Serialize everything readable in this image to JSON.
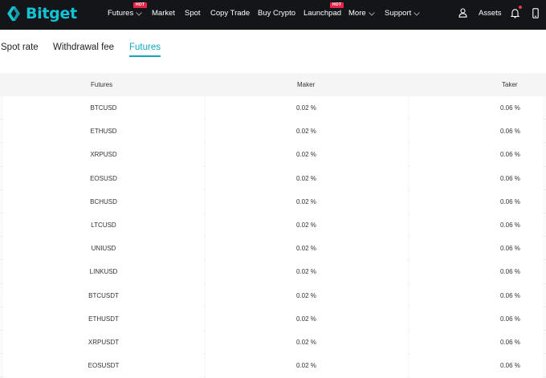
{
  "brand": {
    "name": "Bitget",
    "color": "#12c4d6"
  },
  "nav": {
    "futures": "Futures",
    "market": "Market",
    "spot": "Spot",
    "copy_trade": "Copy Trade",
    "buy_crypto": "Buy Crypto",
    "launchpad": "Launchpad",
    "more": "More",
    "support": "Support",
    "assets": "Assets",
    "hot_badge": "HOT"
  },
  "tabs": [
    {
      "label": "Spot rate",
      "active": false
    },
    {
      "label": "Withdrawal fee",
      "active": false
    },
    {
      "label": "Futures",
      "active": true
    }
  ],
  "table": {
    "headers": {
      "futures": "Futures",
      "maker": "Maker",
      "taker": "Taker"
    },
    "rows": [
      {
        "pair": "BTCUSD",
        "maker": "0.02 %",
        "taker": "0.06 %"
      },
      {
        "pair": "ETHUSD",
        "maker": "0.02 %",
        "taker": "0.06 %"
      },
      {
        "pair": "XRPUSD",
        "maker": "0.02 %",
        "taker": "0.06 %"
      },
      {
        "pair": "EOSUSD",
        "maker": "0.02 %",
        "taker": "0.06 %"
      },
      {
        "pair": "BCHUSD",
        "maker": "0.02 %",
        "taker": "0.06 %"
      },
      {
        "pair": "LTCUSD",
        "maker": "0.02 %",
        "taker": "0.06 %"
      },
      {
        "pair": "UNIUSD",
        "maker": "0.02 %",
        "taker": "0.06 %"
      },
      {
        "pair": "LINKUSD",
        "maker": "0.02 %",
        "taker": "0.06 %"
      },
      {
        "pair": "BTCUSDT",
        "maker": "0.02 %",
        "taker": "0.06 %"
      },
      {
        "pair": "ETHUSDT",
        "maker": "0.02 %",
        "taker": "0.06 %"
      },
      {
        "pair": "XRPUSDT",
        "maker": "0.02 %",
        "taker": "0.06 %"
      },
      {
        "pair": "EOSUSDT",
        "maker": "0.02 %",
        "taker": "0.06 %"
      }
    ]
  },
  "colors": {
    "topbar_bg": "#141518",
    "accent": "#12a5c0",
    "hot_badge": "#e6244a",
    "notification_dot": "#f0364f"
  },
  "icons": {
    "logo": "bitget-logo-icon",
    "user": "user-icon",
    "bell": "bell-icon",
    "phone": "phone-icon",
    "chevron": "chevron-down-icon"
  }
}
